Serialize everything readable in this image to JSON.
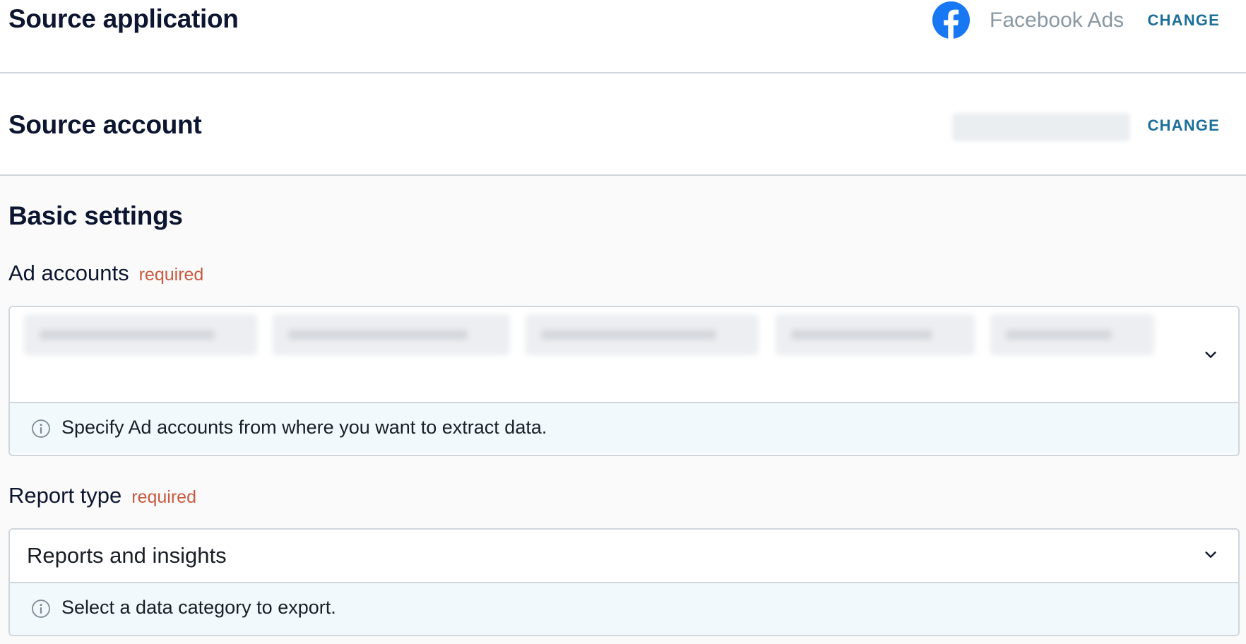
{
  "source_application": {
    "title": "Source application",
    "app_name": "Facebook Ads",
    "app_icon": "facebook-icon",
    "change_label": "CHANGE"
  },
  "source_account": {
    "title": "Source account",
    "change_label": "CHANGE"
  },
  "basic_settings": {
    "title": "Basic settings",
    "ad_accounts": {
      "label": "Ad accounts",
      "required_label": "required",
      "hint": "Specify Ad accounts from where you want to extract data."
    },
    "report_type": {
      "label": "Report type",
      "required_label": "required",
      "selected_value": "Reports and insights",
      "hint": "Select a data category to export."
    }
  },
  "colors": {
    "accent": "#1b6f98",
    "required": "#c95a40",
    "facebook_blue": "#1877f2",
    "hint_background": "#f1f9fc",
    "border": "#cfd6dc"
  }
}
